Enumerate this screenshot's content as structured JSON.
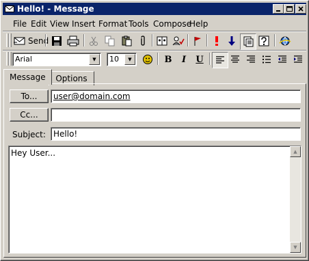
{
  "window": {
    "title": "Hello! - Message"
  },
  "menu": {
    "items": [
      "File",
      "Edit",
      "View",
      "Insert",
      "Format",
      "Tools",
      "Compose",
      "Help"
    ]
  },
  "toolbar": {
    "send_label": "Send",
    "icons": [
      "save-icon",
      "print-icon",
      "cut-icon",
      "copy-icon",
      "paste-icon",
      "attach-icon",
      "address-book-icon",
      "check-names-icon",
      "flag-icon",
      "high-priority-icon",
      "low-priority-icon",
      "stationery-icon",
      "help-icon",
      "online-icon"
    ]
  },
  "format": {
    "font": "Arial",
    "size": "10"
  },
  "tabs": [
    {
      "label": "Message"
    },
    {
      "label": "Options"
    }
  ],
  "header": {
    "to_button": "To...",
    "cc_button": "Cc...",
    "subject_label": "Subject:",
    "to_value": "user@domain.com",
    "cc_value": "",
    "subject_value": "Hello!"
  },
  "body": {
    "text": "Hey User..."
  },
  "colors": {
    "titlebar": "#0a246a",
    "face": "#d4d0c8"
  }
}
